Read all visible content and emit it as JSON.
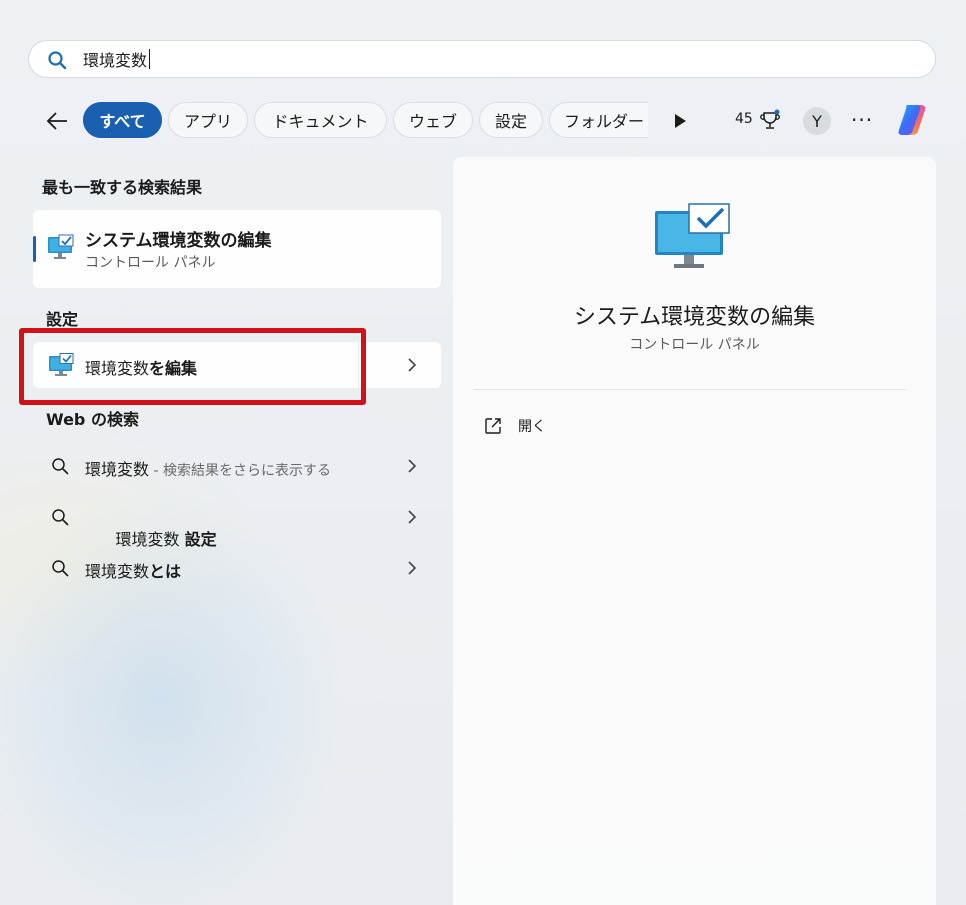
{
  "search": {
    "query": "環境変数",
    "icon": "search-icon"
  },
  "filters": {
    "tabs": [
      {
        "label": "すべて",
        "active": true
      },
      {
        "label": "アプリ",
        "active": false
      },
      {
        "label": "ドキュメント",
        "active": false
      },
      {
        "label": "ウェブ",
        "active": false
      },
      {
        "label": "設定",
        "active": false
      },
      {
        "label": "フォルダー",
        "active": false
      }
    ],
    "points": "45",
    "avatar_initial": "Y",
    "more": "···"
  },
  "results": {
    "best_match_heading": "最も一致する検索結果",
    "best_match": {
      "title": "システム環境変数の編集",
      "subtitle": "コントロール パネル"
    },
    "settings_heading": "設定",
    "settings_item": {
      "label_prefix": "環境変数",
      "label_suffix": "を編集"
    },
    "web_heading": "Web の検索",
    "web_items": [
      {
        "query": "環境変数",
        "suffix": "",
        "hint": " - 検索結果をさらに表示する"
      },
      {
        "query": "環境変数 ",
        "suffix": "設定",
        "hint": ""
      },
      {
        "query": "環境変数",
        "suffix": "とは",
        "hint": ""
      }
    ]
  },
  "preview": {
    "title": "システム環境変数の編集",
    "subtitle": "コントロール パネル",
    "actions": [
      {
        "label": "開く",
        "icon": "open-external-icon"
      }
    ]
  },
  "colors": {
    "accent": "#1a5fb0",
    "highlight_box": "#d01218"
  }
}
